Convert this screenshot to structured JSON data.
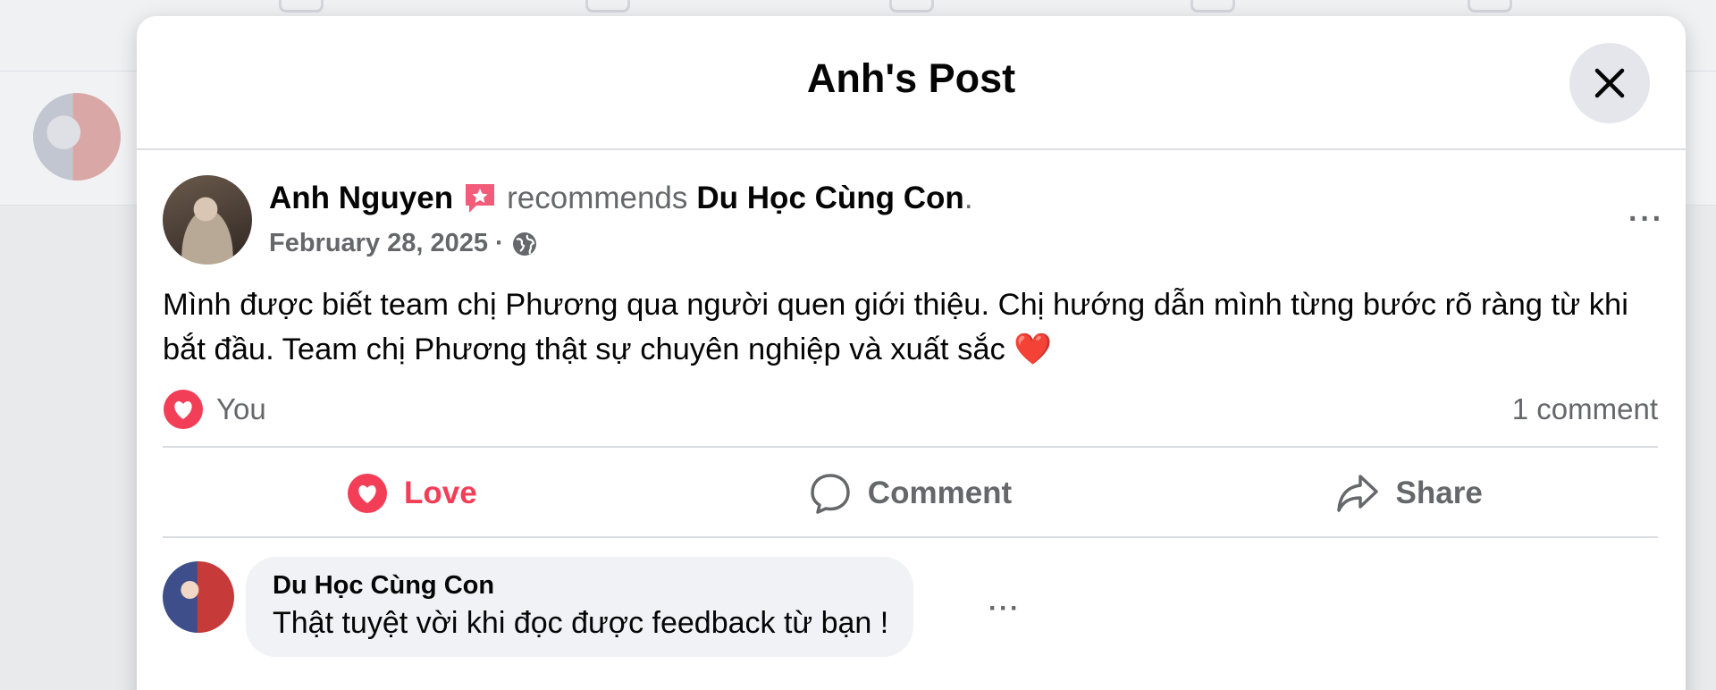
{
  "dialog": {
    "title": "Anh's Post",
    "close_label": "Close"
  },
  "post": {
    "author": "Anh Nguyen",
    "action_text": "recommends",
    "page_name": "Du Học Cùng Con",
    "page_suffix": ".",
    "date": "February 28, 2025",
    "separator": "·",
    "privacy_icon": "globe-icon",
    "more_label": "···",
    "body": "Mình được biết team chị Phương qua người quen giới thiệu. Chị hướng dẫn mình từng bước rõ ràng từ khi bắt đầu. Team chị Phương thật sự chuyên nghiệp và xuất sắc ❤️",
    "reaction_summary": "You",
    "comment_count": "1 comment"
  },
  "actions": {
    "love": "Love",
    "comment": "Comment",
    "share": "Share"
  },
  "comment": {
    "author": "Du Học Cùng Con",
    "text": "Thật tuyệt vời khi đọc được feedback từ bạn !",
    "more_label": "···"
  },
  "colors": {
    "love": "#f33e58",
    "muted": "#65676b",
    "bubble": "#f0f2f5"
  }
}
